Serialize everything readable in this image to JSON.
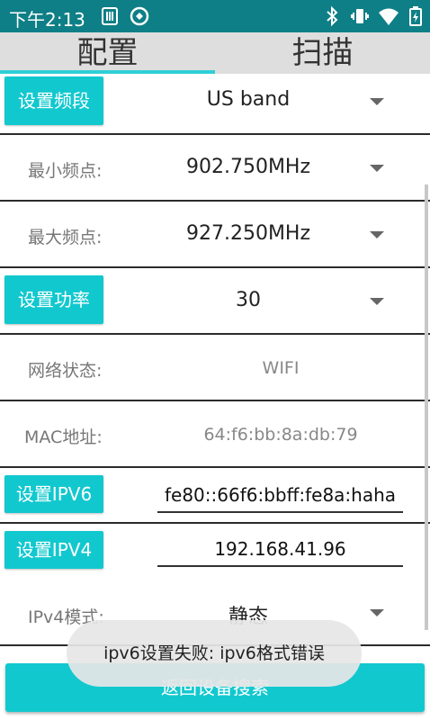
{
  "status_bar": {
    "time": "下午2:13",
    "icons": [
      "sim-card-icon",
      "sync-icon",
      "bluetooth-icon",
      "vibrate-icon",
      "wifi-icon",
      "battery-charging-icon"
    ]
  },
  "tabs": [
    {
      "label": "配置",
      "selected": true
    },
    {
      "label": "扫描",
      "selected": false
    }
  ],
  "settings": {
    "band": {
      "button": "设置频段",
      "value": "US band"
    },
    "min_freq": {
      "label": "最小频点:",
      "value": "902.750MHz"
    },
    "max_freq": {
      "label": "最大频点:",
      "value": "927.250MHz"
    },
    "power": {
      "button": "设置功率",
      "value": "30"
    },
    "network": {
      "label": "网络状态:",
      "value": "WIFI"
    },
    "mac": {
      "label": "MAC地址:",
      "value": "64:f6:bb:8a:db:79"
    },
    "ipv6": {
      "button": "设置IPV6",
      "value": "fe80::66f6:bbff:fe8a:haha"
    },
    "ipv4": {
      "button": "设置IPV4",
      "value": "192.168.41.96"
    },
    "ipv4_mode": {
      "label": "IPv4模式:",
      "value": "静态"
    }
  },
  "bottom_button": "返回设备搜索",
  "toast": "ipv6设置失败: ipv6格式错误",
  "colors": {
    "status_bar": "#0E7F86",
    "accent": "#12C8CF",
    "tab_bar": "#DEDEDE",
    "indicator": "#2ECFD6"
  }
}
